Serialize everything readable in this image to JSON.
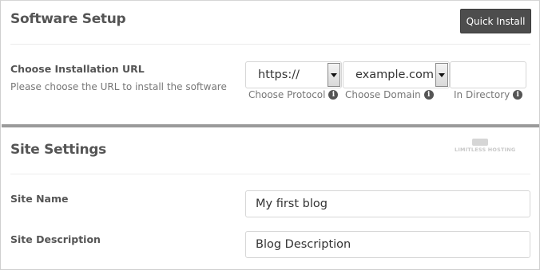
{
  "software_setup": {
    "title": "Software Setup",
    "quick_install_label": "Quick Install",
    "installation_url": {
      "label": "Choose Installation URL",
      "description": "Please choose the URL to install the software",
      "protocol": {
        "value": "https://",
        "hint": "Choose Protocol"
      },
      "domain": {
        "value": "example.com",
        "hint": "Choose Domain"
      },
      "directory": {
        "value": "",
        "hint": "In Directory"
      }
    }
  },
  "site_settings": {
    "title": "Site Settings",
    "logo_text": "LIMITLESS HOSTING",
    "site_name": {
      "label": "Site Name",
      "value": "My first blog"
    },
    "site_description": {
      "label": "Site Description",
      "value": "Blog Description"
    }
  },
  "icons": {
    "info": "info-circle-icon",
    "dropdown": "chevron-down-icon"
  },
  "colors": {
    "button_bg": "#4d4d4d",
    "divider": "#9a9a9a",
    "text": "#555555"
  }
}
